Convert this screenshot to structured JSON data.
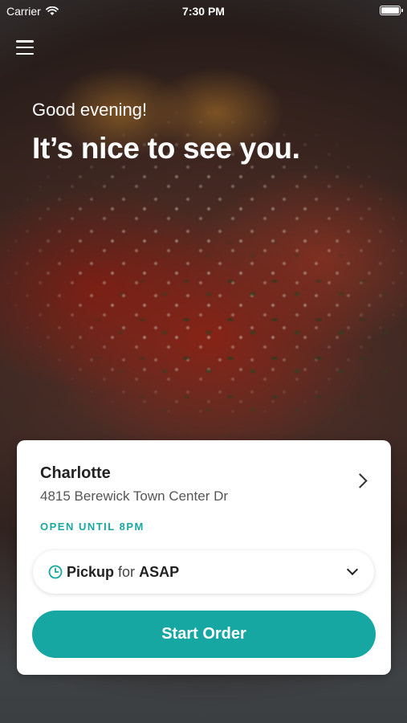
{
  "status_bar": {
    "carrier": "Carrier",
    "time": "7:30 PM"
  },
  "hero": {
    "greeting": "Good evening!",
    "headline": "It’s nice to see you."
  },
  "location": {
    "name": "Charlotte",
    "address": "4815 Berewick Town Center Dr",
    "hours_status": "OPEN UNTIL 8PM"
  },
  "order_mode": {
    "mode": "Pickup",
    "connector": "for",
    "time": "ASAP"
  },
  "actions": {
    "start_order": "Start Order"
  },
  "colors": {
    "accent": "#17a7a2"
  }
}
